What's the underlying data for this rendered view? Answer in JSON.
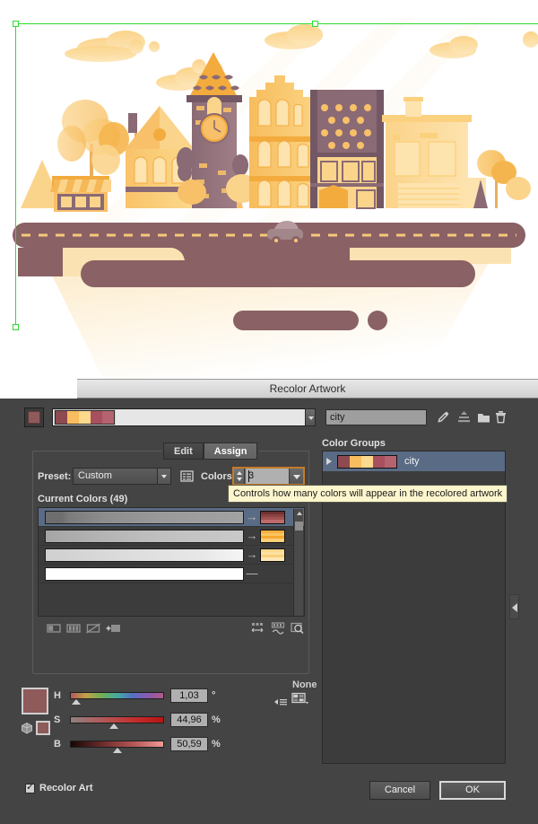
{
  "dialog": {
    "title": "Recolor Artwork",
    "top_bar": {
      "current_color_hex": "#8e5a5a",
      "group_strip_swatches": [
        "#8e4a50",
        "#f7bd5e",
        "#fbd98d",
        "#a8505f",
        "#b5636e"
      ],
      "group_name_value": "city",
      "icons": [
        "eyedropper-icon",
        "save-swatch-icon",
        "new-folder-icon",
        "trash-icon"
      ]
    },
    "tabs": [
      {
        "label": "Edit",
        "active": false
      },
      {
        "label": "Assign",
        "active": true
      }
    ],
    "preset": {
      "label": "Preset:",
      "value": "Custom",
      "menu_icon": "preset-options-icon"
    },
    "colors": {
      "label": "Colors:",
      "value": "3"
    },
    "current_colors": {
      "label": "Current Colors (49)",
      "count": 49,
      "rows": [
        {
          "selected": true,
          "bar_gradient": [
            "#6e6e6e",
            "#7c7c7c",
            "#8d8d8d",
            "#9a9a9a",
            "#a2a2a2"
          ],
          "arrow": "→",
          "target_colors": [
            "#6f3030",
            "#8a4343",
            "#a05050",
            "#c06a6a"
          ]
        },
        {
          "selected": false,
          "bar_gradient": [
            "#a5a5a5",
            "#b2b2b2",
            "#bdbdbd",
            "#c4c4c4",
            "#c9c9c9"
          ],
          "arrow": "→",
          "target_colors": [
            "#f6b040",
            "#f9c45e",
            "#f4a92e",
            "#fbcf7a"
          ]
        },
        {
          "selected": false,
          "bar_gradient": [
            "#cfcfcf",
            "#d8d8d8",
            "#e0e0e0",
            "#e8e8e8",
            "#f2f2f2"
          ],
          "arrow": "→",
          "target_colors": [
            "#fbd98d",
            "#fde0a2",
            "#f9d07a",
            "#fde7b6"
          ]
        },
        {
          "selected": false,
          "bar_gradient": [
            "#ffffff",
            "#ffffff",
            "#ffffff",
            "#ffffff",
            "#ffffff"
          ],
          "arrow": "—",
          "target_colors": []
        }
      ],
      "toolbar_left_icons": [
        "merge-colors-icon",
        "separate-colors-icon",
        "exclude-color-icon",
        "add-color-row-icon"
      ],
      "toolbar_right_icons": [
        "randomize-order-icon",
        "randomize-saturation-icon",
        "color-reduction-options-icon"
      ]
    },
    "hsb": {
      "swatch_hex": "#8e5a5a",
      "cube_icon": "color-mode-cube-icon",
      "small_swatch_hex": "#8e5a5a",
      "sliders": [
        {
          "name": "H",
          "value": "1,03",
          "unit": "°",
          "knob_pct": 3
        },
        {
          "name": "S",
          "value": "44,96",
          "unit": "%",
          "knob_pct": 45
        },
        {
          "name": "B",
          "value": "50,59",
          "unit": "%",
          "knob_pct": 51
        }
      ],
      "menu_icon": "hsb-flyout-menu-icon"
    },
    "limit": {
      "label": "None",
      "icon": "limit-color-library-icon"
    },
    "color_groups": {
      "label": "Color Groups",
      "items": [
        {
          "name": "city",
          "selected": true,
          "swatches": [
            "#8e4a50",
            "#f7bd5e",
            "#fbd98d",
            "#a8505f",
            "#b5636e"
          ]
        }
      ]
    },
    "collapse_arrow_icon": "panel-collapse-left-icon",
    "tooltip": "Controls how many colors will appear in the recolored artwork",
    "footer": {
      "recolor_art_label": "Recolor Art",
      "recolor_art_checked": true,
      "cancel_label": "Cancel",
      "ok_label": "OK"
    }
  },
  "artwork": {
    "description": "flat-design city street illustration with clock tower",
    "selection_color": "#2fdb2f",
    "palette": {
      "road": "#8a6165",
      "road_dash": "#f6c97a",
      "building_light": "#fbd98d",
      "building_mid": "#f9c369",
      "building_dark": "#f5ab45",
      "tower_dark": "#8a6a74",
      "sky": "#ffffff",
      "shadow": "#fbe8c0"
    }
  }
}
